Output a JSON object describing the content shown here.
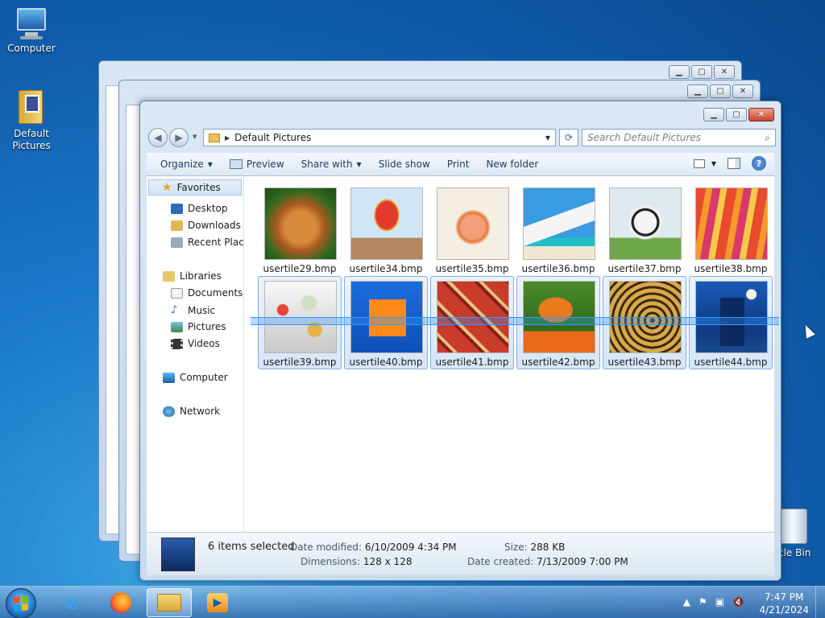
{
  "desktop": {
    "icons": [
      {
        "label": "Computer"
      },
      {
        "label": "Default\nPictures"
      },
      {
        "label": "cle Bin"
      }
    ]
  },
  "window": {
    "address": {
      "crumb": "Default Pictures"
    },
    "search": {
      "placeholder": "Search Default Pictures"
    },
    "toolbar": {
      "organize": "Organize",
      "preview": "Preview",
      "share_with": "Share with",
      "slide_show": "Slide show",
      "print": "Print",
      "new_folder": "New folder"
    },
    "nav": {
      "favorites": "Favorites",
      "desktop": "Desktop",
      "downloads": "Downloads",
      "recent": "Recent Places",
      "libraries": "Libraries",
      "documents": "Documents",
      "music": "Music",
      "pictures": "Pictures",
      "videos": "Videos",
      "computer": "Computer",
      "network": "Network"
    },
    "files": [
      {
        "name": "usertile29.bmp"
      },
      {
        "name": "usertile34.bmp"
      },
      {
        "name": "usertile35.bmp"
      },
      {
        "name": "usertile36.bmp"
      },
      {
        "name": "usertile37.bmp"
      },
      {
        "name": "usertile38.bmp"
      },
      {
        "name": "usertile39.bmp"
      },
      {
        "name": "usertile40.bmp"
      },
      {
        "name": "usertile41.bmp"
      },
      {
        "name": "usertile42.bmp"
      },
      {
        "name": "usertile43.bmp"
      },
      {
        "name": "usertile44.bmp"
      }
    ],
    "details": {
      "selected": "6 items selected",
      "date_modified_label": "Date modified:",
      "date_modified": "6/10/2009 4:34 PM",
      "dimensions_label": "Dimensions:",
      "dimensions": "128 x 128",
      "size_label": "Size:",
      "size": "288 KB",
      "date_created_label": "Date created:",
      "date_created": "7/13/2009 7:00 PM"
    }
  },
  "taskbar": {
    "time": "7:47 PM",
    "date": "4/21/2024"
  },
  "colors": {
    "selection_border": "#84acdd",
    "selection_fill": "#d5e6f7",
    "marquee": "#3399ff"
  }
}
